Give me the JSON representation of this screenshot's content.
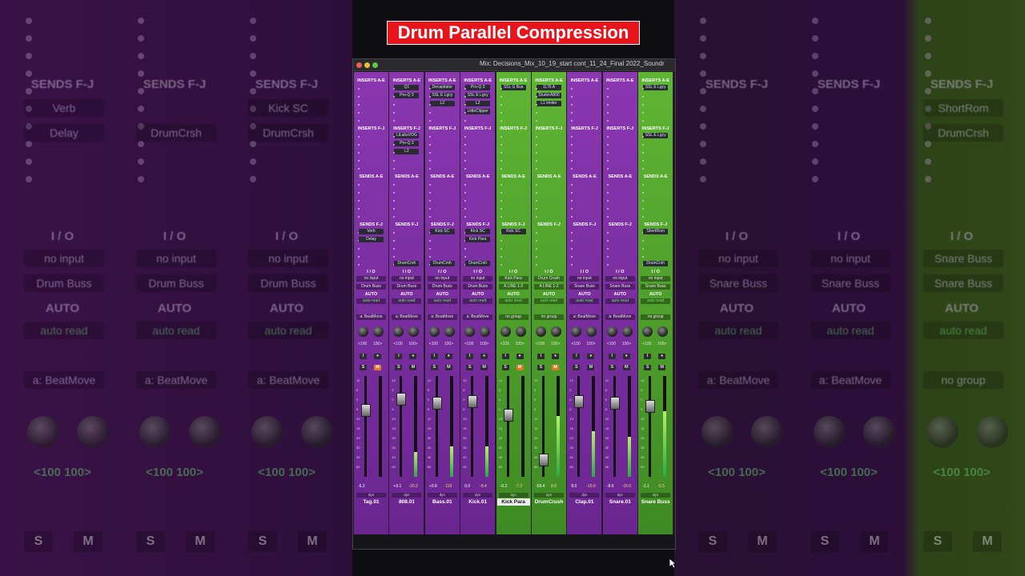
{
  "overlay_title": "Drum Parallel Compression",
  "window": {
    "title": "Mix: Decisions_Mix_10_19_start cont_11_24_Final 2022_Soundr",
    "colors": {
      "purple": "#7a2c9e",
      "green": "#4ea52f",
      "close": "#ec5f57",
      "min": "#e7be3c",
      "max": "#5fc74a"
    }
  },
  "section_labels": {
    "inserts_ae": "INSERTS A-E",
    "inserts_fj": "INSERTS F-J",
    "sends_ae": "SENDS A-E",
    "sends_fj": "SENDS F-J",
    "io": "I / O",
    "auto": "AUTO"
  },
  "strips": [
    {
      "name": "Tag.01",
      "color": "purple",
      "inserts_ae": [],
      "inserts_fj": [],
      "sends_fj": [
        "Verb",
        "Delay"
      ],
      "input": "no input",
      "output": "Drum Buss",
      "auto": "auto read",
      "group": "a: BeatMove",
      "pan_l": "<100",
      "pan_r": "100>",
      "vol": "-5.2",
      "peak": "",
      "mute_on": true
    },
    {
      "name": "808.01",
      "color": "purple",
      "inserts_ae": [
        "Q1",
        "Pro-Q 3"
      ],
      "inserts_fj": [
        "LiLabsVOG",
        "Pro-Q 3",
        "L2"
      ],
      "sends_fj": [
        "DrumCrsh"
      ],
      "input": "no input",
      "output": "Drum Buss",
      "auto": "auto read",
      "group": "a: BeatMove",
      "pan_l": "<100",
      "pan_r": "100>",
      "vol": "+3.1",
      "peak": "-20.2",
      "mute_on": false
    },
    {
      "name": "Bass.01",
      "color": "purple",
      "inserts_ae": [
        "Decapitator",
        "SSL E Lgcy",
        "L2"
      ],
      "inserts_fj": [],
      "sends_fj": [
        "Kick SC",
        "DrumCrsh"
      ],
      "input": "no input",
      "output": "Drum Buss",
      "auto": "auto read",
      "group": "a: BeatMove",
      "pan_l": "<100",
      "pan_r": "100>",
      "vol": "+0.9",
      "peak": "-110",
      "mute_on": false
    },
    {
      "name": "Kick.01",
      "color": "purple",
      "inserts_ae": [
        "Pro-Q 3",
        "SSL E Lgcy",
        "L2",
        "LittleClipper"
      ],
      "inserts_fj": [],
      "sends_fj": [
        "Kick SC",
        "Kick Para",
        "DrumCrsh"
      ],
      "input": "no input",
      "output": "Drum Buss",
      "auto": "auto read",
      "group": "a: BeatMove",
      "pan_l": "<100",
      "pan_r": "100>",
      "vol": "0.0",
      "peak": "-8.4",
      "mute_on": false
    },
    {
      "name": "Kick Para",
      "color": "green",
      "inserts_ae": [
        "SSL G Bus"
      ],
      "inserts_fj": [],
      "sends_fj": [
        "Kick SC"
      ],
      "input": "Kick Para",
      "output": "A LINE 1-2",
      "auto": "auto read",
      "group": "no group",
      "pan_l": "<100",
      "pan_r": "100>",
      "vol": "-6.2",
      "peak": "-7.2",
      "mute_on": true
    },
    {
      "name": "DrumCrush",
      "color": "green",
      "inserts_ae": [
        "1176 A",
        "StuderA800",
        "L1 limiter"
      ],
      "inserts_fj": [],
      "sends_fj": [],
      "input": "Drum Crush",
      "output": "A LINE 1-2",
      "auto": "auto read",
      "group": "no group",
      "pan_l": "<100",
      "pan_r": "100>",
      "vol": "-59.4",
      "peak": "8.8",
      "mute_on": true
    },
    {
      "name": "Clap.01",
      "color": "purple",
      "inserts_ae": [],
      "inserts_fj": [],
      "sends_fj": [],
      "input": "no input",
      "output": "Snare Buss",
      "auto": "auto read",
      "group": "a: BeatMove",
      "pan_l": "<100",
      "pan_r": "100>",
      "vol": "8.0",
      "peak": "-15.0",
      "mute_on": false
    },
    {
      "name": "Snare.01",
      "color": "purple",
      "inserts_ae": [],
      "inserts_fj": [],
      "sends_fj": [],
      "input": "no input",
      "output": "Snare Buss",
      "auto": "auto read",
      "group": "a: BeatMove",
      "pan_l": "<100",
      "pan_r": "100>",
      "vol": "-8.6",
      "peak": "-15.0",
      "mute_on": false
    },
    {
      "name": "Snare Buss",
      "color": "green",
      "inserts_ae": [
        "SSL E Lgcy"
      ],
      "inserts_fj": [
        "SSL E Lgcy"
      ],
      "sends_fj": [
        "ShortRom",
        "DrumCrsh"
      ],
      "input": "no input",
      "output": "Snare Buss",
      "auto": "auto read",
      "group": "no group",
      "pan_l": "<100",
      "pan_r": "100>",
      "vol": "-1.1",
      "peak": "-5.5",
      "mute_on": false
    }
  ],
  "meter_levels": [
    0.0,
    0.25,
    0.3,
    0.3,
    0.0,
    0.6,
    0.45,
    0.4,
    0.65
  ],
  "fader_levels": [
    0.7,
    0.82,
    0.78,
    0.8,
    0.65,
    0.18,
    0.8,
    0.78,
    0.75
  ],
  "background": {
    "left_cols": [
      {
        "sends": "SENDS F-J",
        "send1": "Verb",
        "send2": "Delay",
        "io": "I / O",
        "input": "no input",
        "output": "Drum Buss",
        "auto": "AUTO",
        "autoval": "auto read",
        "group": "a: BeatMove",
        "pan_l": "<100",
        "pan_r": "100>",
        "s": "S",
        "m": "M"
      },
      {
        "sends": "SENDS F-J",
        "send1": "",
        "send2": "DrumCrsh",
        "io": "I / O",
        "input": "no input",
        "output": "Drum Buss",
        "auto": "AUTO",
        "autoval": "auto read",
        "group": "a: BeatMove",
        "pan_l": "<100",
        "pan_r": "100>",
        "s": "S",
        "m": "M"
      },
      {
        "sends": "SENDS F-J",
        "send1": "Kick SC",
        "send2": "DrumCrsh",
        "io": "I / O",
        "input": "no input",
        "output": "Drum Buss",
        "auto": "AUTO",
        "autoval": "auto read",
        "group": "a: BeatMove",
        "pan_l": "<100",
        "pan_r": "100>",
        "s": "S",
        "m": "M"
      }
    ],
    "right_cols": [
      {
        "sends": "SENDS F-J",
        "send1": "",
        "send2": "",
        "io": "I / O",
        "input": "no input",
        "output": "Snare Buss",
        "auto": "AUTO",
        "autoval": "auto read",
        "group": "a: BeatMove",
        "pan_l": "<100",
        "pan_r": "100>",
        "s": "S",
        "m": "M"
      },
      {
        "sends": "SENDS F-J",
        "send1": "",
        "send2": "",
        "io": "I / O",
        "input": "no input",
        "output": "Snare Buss",
        "auto": "AUTO",
        "autoval": "auto read",
        "group": "a: BeatMove",
        "pan_l": "<100",
        "pan_r": "100>",
        "s": "S",
        "m": "M"
      },
      {
        "sends": "SENDS F-J",
        "send1": "ShortRom",
        "send2": "DrumCrsh",
        "io": "I / O",
        "input": "Snare Buss",
        "output": "Snare Buss",
        "auto": "AUTO",
        "autoval": "auto read",
        "group": "no group",
        "pan_l": "<100",
        "pan_r": "100>",
        "s": "S",
        "m": "M"
      }
    ]
  }
}
